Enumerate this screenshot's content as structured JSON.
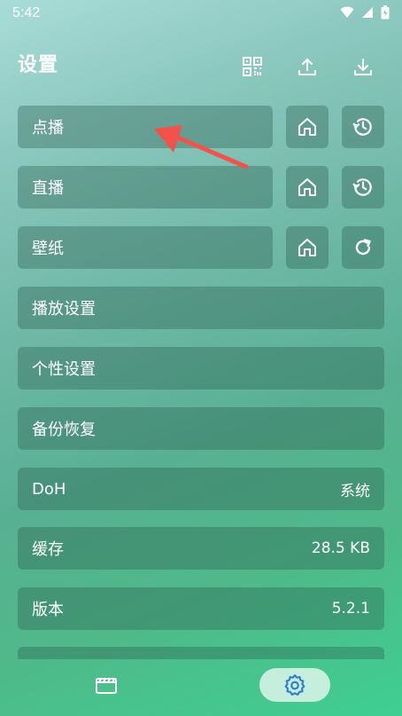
{
  "status": {
    "time": "5:42"
  },
  "header": {
    "title": "设置"
  },
  "rows": {
    "vod": {
      "label": "点播"
    },
    "live": {
      "label": "直播"
    },
    "wallpaper": {
      "label": "壁纸"
    },
    "playback": {
      "label": "播放设置"
    },
    "personal": {
      "label": "个性设置"
    },
    "backup": {
      "label": "备份恢复"
    },
    "doh": {
      "label": "DoH",
      "value": "系统"
    },
    "cache": {
      "label": "缓存",
      "value": "28.5 KB"
    },
    "version": {
      "label": "版本",
      "value": "5.2.1"
    }
  },
  "icons": {
    "header": [
      "qr-code-icon",
      "upload-icon",
      "download-icon"
    ],
    "row_actions": [
      "home-icon",
      "history-icon",
      "refresh-icon"
    ],
    "nav": [
      "film-icon",
      "gear-icon"
    ]
  },
  "colors": {
    "annotation_arrow": "#f2524a",
    "nav_active_icon": "#2f7fcf"
  }
}
